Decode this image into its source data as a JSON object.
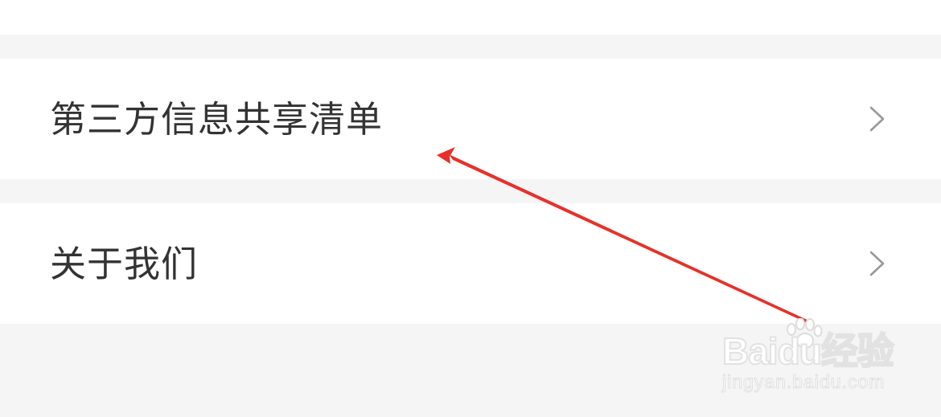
{
  "list": {
    "items": [
      {
        "label": "第三方信息共享清单",
        "icon": "chevron-right-icon"
      },
      {
        "label": "关于我们",
        "icon": "chevron-right-icon"
      }
    ]
  },
  "watermark": {
    "brand": "Baidu经验",
    "url": "jingyan.baidu.com"
  },
  "colors": {
    "background": "#f5f5f5",
    "card": "#ffffff",
    "text": "#333333",
    "chevron": "#999999",
    "arrow": "#e8302a"
  }
}
